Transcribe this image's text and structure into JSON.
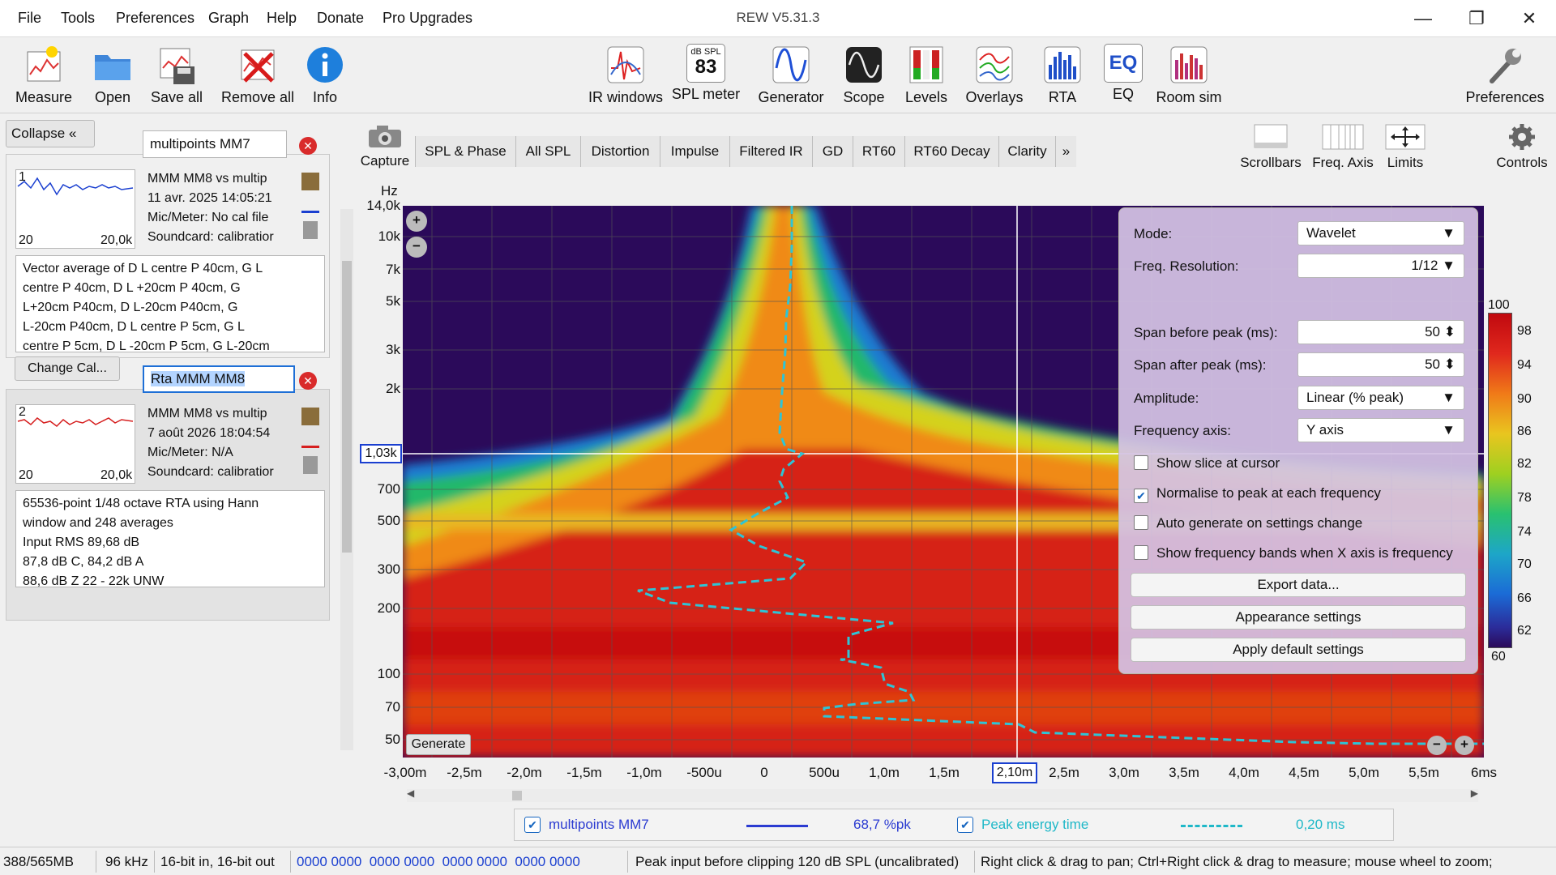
{
  "window": {
    "title": "REW V5.31.3"
  },
  "menu": [
    "File",
    "Tools",
    "Preferences",
    "Graph",
    "Help",
    "Donate",
    "Pro Upgrades"
  ],
  "toolbar": {
    "left": [
      {
        "label": "Measure",
        "icon": "measure-icon"
      },
      {
        "label": "Open",
        "icon": "folder-icon"
      },
      {
        "label": "Save all",
        "icon": "save-icon"
      },
      {
        "label": "Remove all",
        "icon": "remove-icon"
      },
      {
        "label": "Info",
        "icon": "info-icon"
      }
    ],
    "center": [
      {
        "label": "IR windows",
        "icon": "ir-windows-icon"
      },
      {
        "label": "SPL meter",
        "icon": "spl-meter-icon",
        "badge_top": "dB SPL",
        "badge_value": "83"
      },
      {
        "label": "Generator",
        "icon": "generator-icon"
      },
      {
        "label": "Scope",
        "icon": "scope-icon"
      },
      {
        "label": "Levels",
        "icon": "levels-icon"
      },
      {
        "label": "Overlays",
        "icon": "overlays-icon"
      },
      {
        "label": "RTA",
        "icon": "rta-icon"
      },
      {
        "label": "EQ",
        "icon": "eq-icon"
      },
      {
        "label": "Room sim",
        "icon": "room-sim-icon"
      }
    ],
    "right": {
      "label": "Preferences",
      "icon": "wrench-icon"
    }
  },
  "left": {
    "collapse": "Collapse",
    "change_cal": "Change Cal...",
    "measurements": [
      {
        "name": "multipoints MM7",
        "index": "1",
        "title": "MMM MM8 vs multip",
        "date": "11 avr. 2025 14:05:21",
        "mic": "Mic/Meter: No cal file",
        "soundcard": "Soundcard: calibratior",
        "axis_min": "20",
        "axis_max": "20,0k",
        "notes": [
          "Vector average of D L centre P 40cm, G L",
          "centre P 40cm, D L +20cm P 40cm, G",
          "L+20cm P40cm, D L-20cm P40cm, G",
          "L-20cm P40cm, D L centre P 5cm, G L",
          "centre P 5cm, D L -20cm P 5cm, G L-20cm"
        ]
      },
      {
        "name": "Rta MMM MM8",
        "index": "2",
        "title": "MMM MM8 vs multip",
        "date": "7 août 2026 18:04:54",
        "mic": "Mic/Meter: N/A",
        "soundcard": "Soundcard: calibratior",
        "axis_min": "20",
        "axis_max": "20,0k",
        "notes": [
          "65536-point 1/48 octave RTA using Hann",
          "window and 248 averages",
          "Input RMS 89,68 dB",
          "87,8 dB C, 84,2 dB A",
          "88,6 dB Z 22 - 22k UNW"
        ]
      }
    ]
  },
  "graph": {
    "capture": "Capture",
    "tabs": [
      "SPL & Phase",
      "All SPL",
      "Distortion",
      "Impulse",
      "Filtered IR",
      "GD",
      "RT60",
      "RT60 Decay",
      "Clarity"
    ],
    "tab_more": "»",
    "right_tools": [
      {
        "label": "Scrollbars",
        "icon": "scrollbars-icon"
      },
      {
        "label": "Freq. Axis",
        "icon": "freq-axis-icon"
      },
      {
        "label": "Limits",
        "icon": "limits-icon"
      },
      {
        "label": "Controls",
        "icon": "gear-icon"
      }
    ],
    "y_unit": "Hz",
    "y_ticks": [
      "14,0k",
      "10k",
      "7k",
      "5k",
      "3k",
      "2k",
      "1,03k",
      "700",
      "500",
      "300",
      "200",
      "100",
      "70",
      "50"
    ],
    "x_ticks": [
      "-3,00m",
      "-2,5m",
      "-2,0m",
      "-1,5m",
      "-1,0m",
      "-500u",
      "0",
      "500u",
      "1,0m",
      "1,5m",
      "2,10m",
      "2,5m",
      "3,0m",
      "3,5m",
      "4,0m",
      "4,5m",
      "5,0m",
      "5,5m",
      "6ms"
    ],
    "cursor_y": "1,03k",
    "cursor_x": "2,10m",
    "generate": "Generate",
    "colorbar": {
      "ticks": [
        "100",
        "98",
        "94",
        "90",
        "86",
        "82",
        "78",
        "74",
        "70",
        "66",
        "62",
        "60"
      ]
    }
  },
  "controls": {
    "mode_label": "Mode:",
    "mode_value": "Wavelet",
    "freq_res_label": "Freq. Resolution:",
    "freq_res_value": "1/12",
    "span_before_label": "Span before peak (ms):",
    "span_before_value": "50",
    "span_after_label": "Span after peak (ms):",
    "span_after_value": "50",
    "amplitude_label": "Amplitude:",
    "amplitude_value": "Linear (% peak)",
    "freq_axis_label": "Frequency axis:",
    "freq_axis_value": "Y axis",
    "checks": [
      {
        "label": "Show slice at cursor",
        "checked": false
      },
      {
        "label": "Normalise to peak at each frequency",
        "checked": true
      },
      {
        "label": "Auto generate on settings change",
        "checked": false
      },
      {
        "label": "Show frequency bands when X axis is frequency",
        "checked": false
      }
    ],
    "buttons": [
      "Export data...",
      "Appearance settings",
      "Apply default settings"
    ]
  },
  "legend": [
    {
      "name": "multipoints MM7",
      "value": "68,7 %pk",
      "color": "#2b3bd1",
      "checked": true
    },
    {
      "name": "Peak energy time",
      "value": "0,20 ms",
      "color": "#1fb8c8",
      "checked": true
    }
  ],
  "status": {
    "memory": "388/565MB",
    "rate": "96 kHz",
    "bits": "16-bit in, 16-bit out",
    "levels": "0000 0000  0000 0000  0000 0000  0000 0000",
    "peak": "Peak input before clipping 120 dB SPL (uncalibrated)",
    "hint": "Right click & drag to pan; Ctrl+Right click & drag to measure; mouse wheel to zoom;"
  }
}
